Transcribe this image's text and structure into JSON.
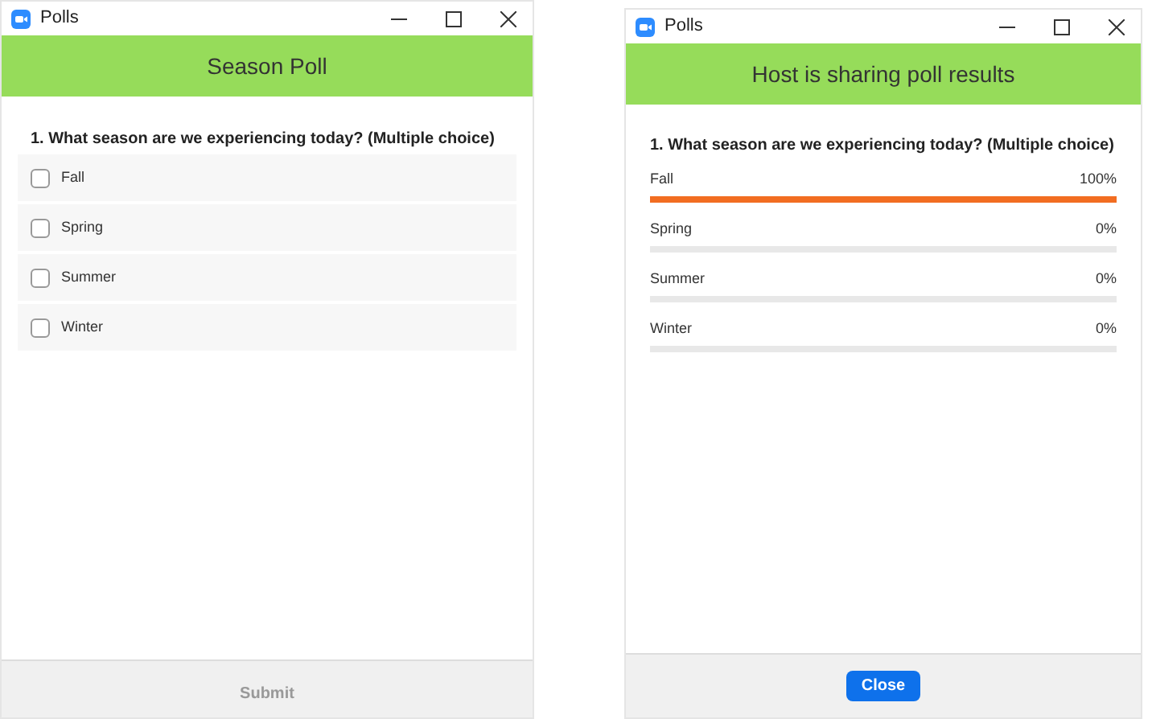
{
  "windows": [
    {
      "kind": "vote",
      "title": "Polls",
      "header": "Season Poll",
      "question": "1. What season are we experiencing today? (Multiple choice)",
      "options": [
        {
          "label": "Fall",
          "checked": false
        },
        {
          "label": "Spring",
          "checked": false
        },
        {
          "label": "Summer",
          "checked": false
        },
        {
          "label": "Winter",
          "checked": false
        }
      ],
      "button": {
        "label": "Submit",
        "disabled": true
      }
    },
    {
      "kind": "results",
      "title": "Polls",
      "header": "Host is sharing poll results",
      "question": "1. What season are we experiencing today? (Multiple choice)",
      "results": [
        {
          "label": "Fall",
          "percent": "100%",
          "level": 1
        },
        {
          "label": "Spring",
          "percent": "0%",
          "level": 0
        },
        {
          "label": "Summer",
          "percent": "0%",
          "level": 0
        },
        {
          "label": "Winter",
          "percent": "0%",
          "level": 0
        }
      ],
      "button": {
        "label": "Close",
        "disabled": false
      }
    }
  ]
}
